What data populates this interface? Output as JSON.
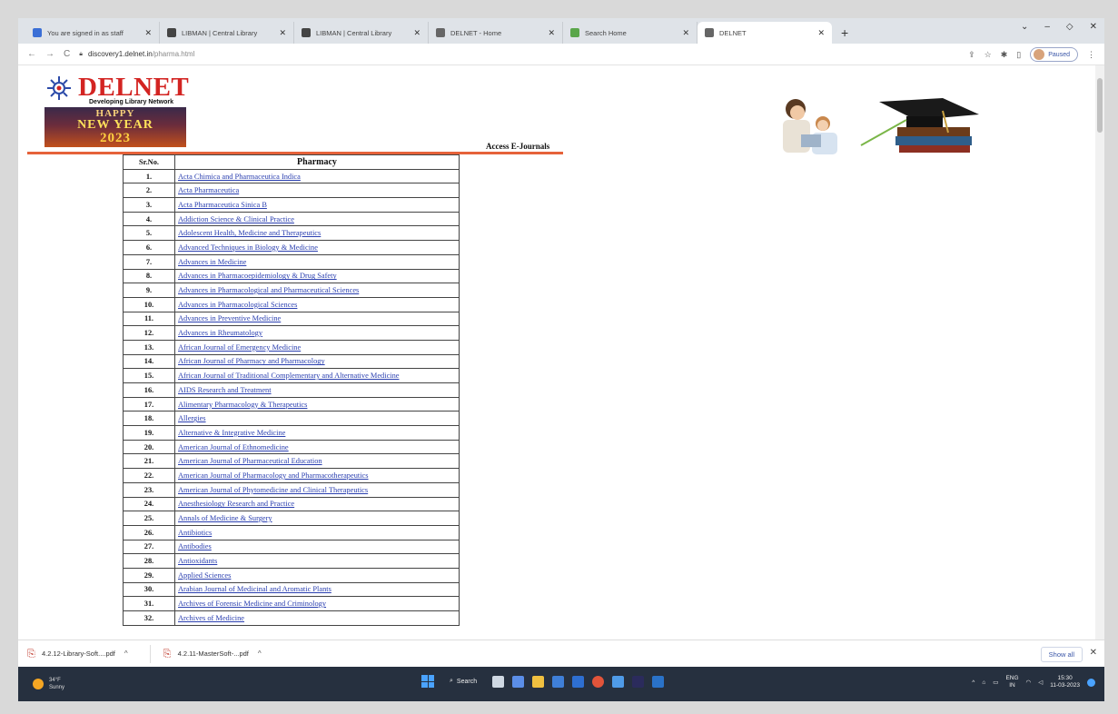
{
  "browser": {
    "tabs": [
      {
        "title": "You are signed in as staff",
        "favicon_color": "#3b6fd6",
        "active": false
      },
      {
        "title": "LIBMAN | Central Library",
        "favicon_color": "#444444",
        "active": false
      },
      {
        "title": "LIBMAN | Central Library",
        "favicon_color": "#444444",
        "active": false
      },
      {
        "title": "DELNET - Home",
        "favicon_color": "#666666",
        "active": false
      },
      {
        "title": "Search Home",
        "favicon_color": "#5aa64a",
        "active": false
      },
      {
        "title": "DELNET",
        "favicon_color": "#666666",
        "active": true
      }
    ],
    "new_tab_label": "+",
    "url_host": "discovery1.delnet.in",
    "url_path": "/pharma.html",
    "profile_status": "Paused"
  },
  "page": {
    "logo_text": "DELNET",
    "tagline": "Developing Library Network",
    "banner": {
      "line1": "HAPPY",
      "line2": "NEW YEAR",
      "line3": "2023"
    },
    "section_label": "Access E-Journals",
    "table": {
      "header_sr": "Sr.No.",
      "header_name": "Pharmacy",
      "rows": [
        {
          "no": "1.",
          "name": "Acta Chimica and Pharmaceutica Indica"
        },
        {
          "no": "2.",
          "name": "Acta Pharmaceutica"
        },
        {
          "no": "3.",
          "name": "Acta Pharmaceutica Sinica B"
        },
        {
          "no": "4.",
          "name": "Addiction Science & Clinical Practice"
        },
        {
          "no": "5.",
          "name": "Adolescent Health, Medicine and Therapeutics"
        },
        {
          "no": "6.",
          "name": "Advanced Techniques in Biology & Medicine"
        },
        {
          "no": "7.",
          "name": "Advances in Medicine"
        },
        {
          "no": "8.",
          "name": "Advances in Pharmacoepidemiology & Drug Safety"
        },
        {
          "no": "9.",
          "name": "Advances in Pharmacological and Pharmaceutical Sciences"
        },
        {
          "no": "10.",
          "name": "Advances in Pharmacological Sciences"
        },
        {
          "no": "11.",
          "name": "Advances in Preventive Medicine"
        },
        {
          "no": "12.",
          "name": "Advances in Rheumatology"
        },
        {
          "no": "13.",
          "name": "African Journal of Emergency Medicine"
        },
        {
          "no": "14.",
          "name": "African Journal of Pharmacy and Pharmacology"
        },
        {
          "no": "15.",
          "name": "African Journal of Traditional Complementary and Alternative Medicine"
        },
        {
          "no": "16.",
          "name": "AIDS Research and Treatment"
        },
        {
          "no": "17.",
          "name": "Alimentary Pharmacology & Therapeutics"
        },
        {
          "no": "18.",
          "name": "Allergies"
        },
        {
          "no": "19.",
          "name": "Alternative & Integrative Medicine"
        },
        {
          "no": "20.",
          "name": "American Journal of Ethnomedicine"
        },
        {
          "no": "21.",
          "name": "American Journal of Pharmaceutical Education"
        },
        {
          "no": "22.",
          "name": "American Journal of Pharmacology and Pharmacotherapeutics"
        },
        {
          "no": "23.",
          "name": "American Journal of Phytomedicine and Clinical Therapeutics"
        },
        {
          "no": "24.",
          "name": "Anesthesiology Research and Practice"
        },
        {
          "no": "25.",
          "name": "Annals of Medicine & Surgery"
        },
        {
          "no": "26.",
          "name": "Antibiotics"
        },
        {
          "no": "27.",
          "name": "Antibodies"
        },
        {
          "no": "28.",
          "name": "Antioxidants"
        },
        {
          "no": "29.",
          "name": "Applied Sciences"
        },
        {
          "no": "30.",
          "name": "Arabian Journal of Medicinal and Aromatic Plants"
        },
        {
          "no": "31.",
          "name": "Archives of Forensic Medicine and Criminology"
        },
        {
          "no": "32.",
          "name": "Archives of Medicine"
        }
      ]
    }
  },
  "downloads": {
    "items": [
      "4.2.12-Library-Soft....pdf",
      "4.2.11-MasterSoft-...pdf"
    ],
    "show_all": "Show all"
  },
  "taskbar": {
    "weather_temp": "34°F",
    "weather_desc": "Sunny",
    "search_label": "Search",
    "lang_top": "ENG",
    "lang_bottom": "IN",
    "time": "15:30",
    "date": "11-03-2023"
  },
  "colors": {
    "link": "#2a3fb0",
    "logo_red": "#d32422",
    "rule_orange": "#e6623a"
  }
}
